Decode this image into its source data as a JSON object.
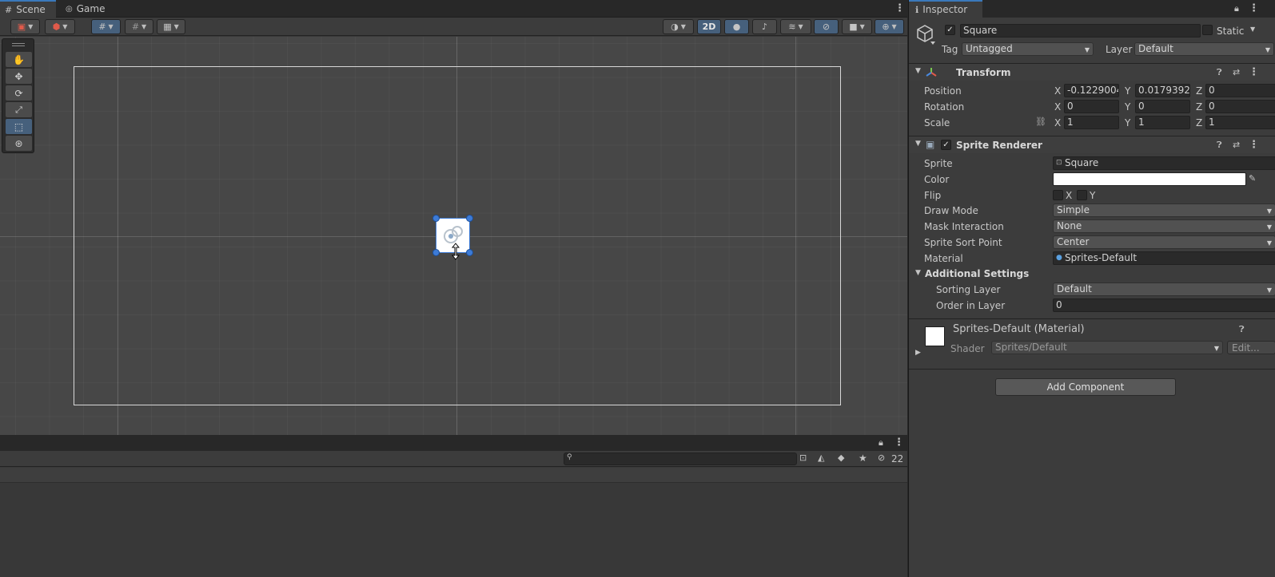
{
  "scene_view": {
    "tabs": [
      {
        "label": "Scene"
      },
      {
        "label": "Game"
      }
    ],
    "toolbar": {
      "mode_2d_label": "2D"
    }
  },
  "hierarchy_panel": {
    "hidden_count": "22"
  },
  "inspector": {
    "tab_label": "Inspector",
    "object": {
      "name": "Square",
      "active": true,
      "static_label": "Static",
      "tag_label": "Tag",
      "tag_value": "Untagged",
      "layer_label": "Layer",
      "layer_value": "Default"
    },
    "transform": {
      "title": "Transform",
      "axis_x": "X",
      "axis_y": "Y",
      "axis_z": "Z",
      "position": {
        "label": "Position",
        "x": "-0.1229004",
        "y": "0.0179392",
        "z": "0"
      },
      "rotation": {
        "label": "Rotation",
        "x": "0",
        "y": "0",
        "z": "0"
      },
      "scale": {
        "label": "Scale",
        "x": "1",
        "y": "1",
        "z": "1"
      }
    },
    "sprite_renderer": {
      "title": "Sprite Renderer",
      "sprite": {
        "label": "Sprite",
        "value": "Square"
      },
      "color": {
        "label": "Color",
        "value": "#ffffff"
      },
      "flip": {
        "label": "Flip",
        "x": "X",
        "y": "Y"
      },
      "draw_mode": {
        "label": "Draw Mode",
        "value": "Simple"
      },
      "mask_interaction": {
        "label": "Mask Interaction",
        "value": "None"
      },
      "sprite_sort_point": {
        "label": "Sprite Sort Point",
        "value": "Center"
      },
      "material": {
        "label": "Material",
        "value": "Sprites-Default"
      },
      "additional_settings": {
        "label": "Additional Settings"
      },
      "sorting_layer": {
        "label": "Sorting Layer",
        "value": "Default"
      },
      "order_in_layer": {
        "label": "Order in Layer",
        "value": "0"
      }
    },
    "material_section": {
      "title": "Sprites-Default (Material)",
      "shader_label": "Shader",
      "shader_value": "Sprites/Default",
      "edit_label": "Edit..."
    },
    "add_component_label": "Add Component"
  },
  "colors": {
    "accent": "#3a79bb",
    "toggle_on": "#46607c",
    "handle": "#3d7bd6"
  }
}
